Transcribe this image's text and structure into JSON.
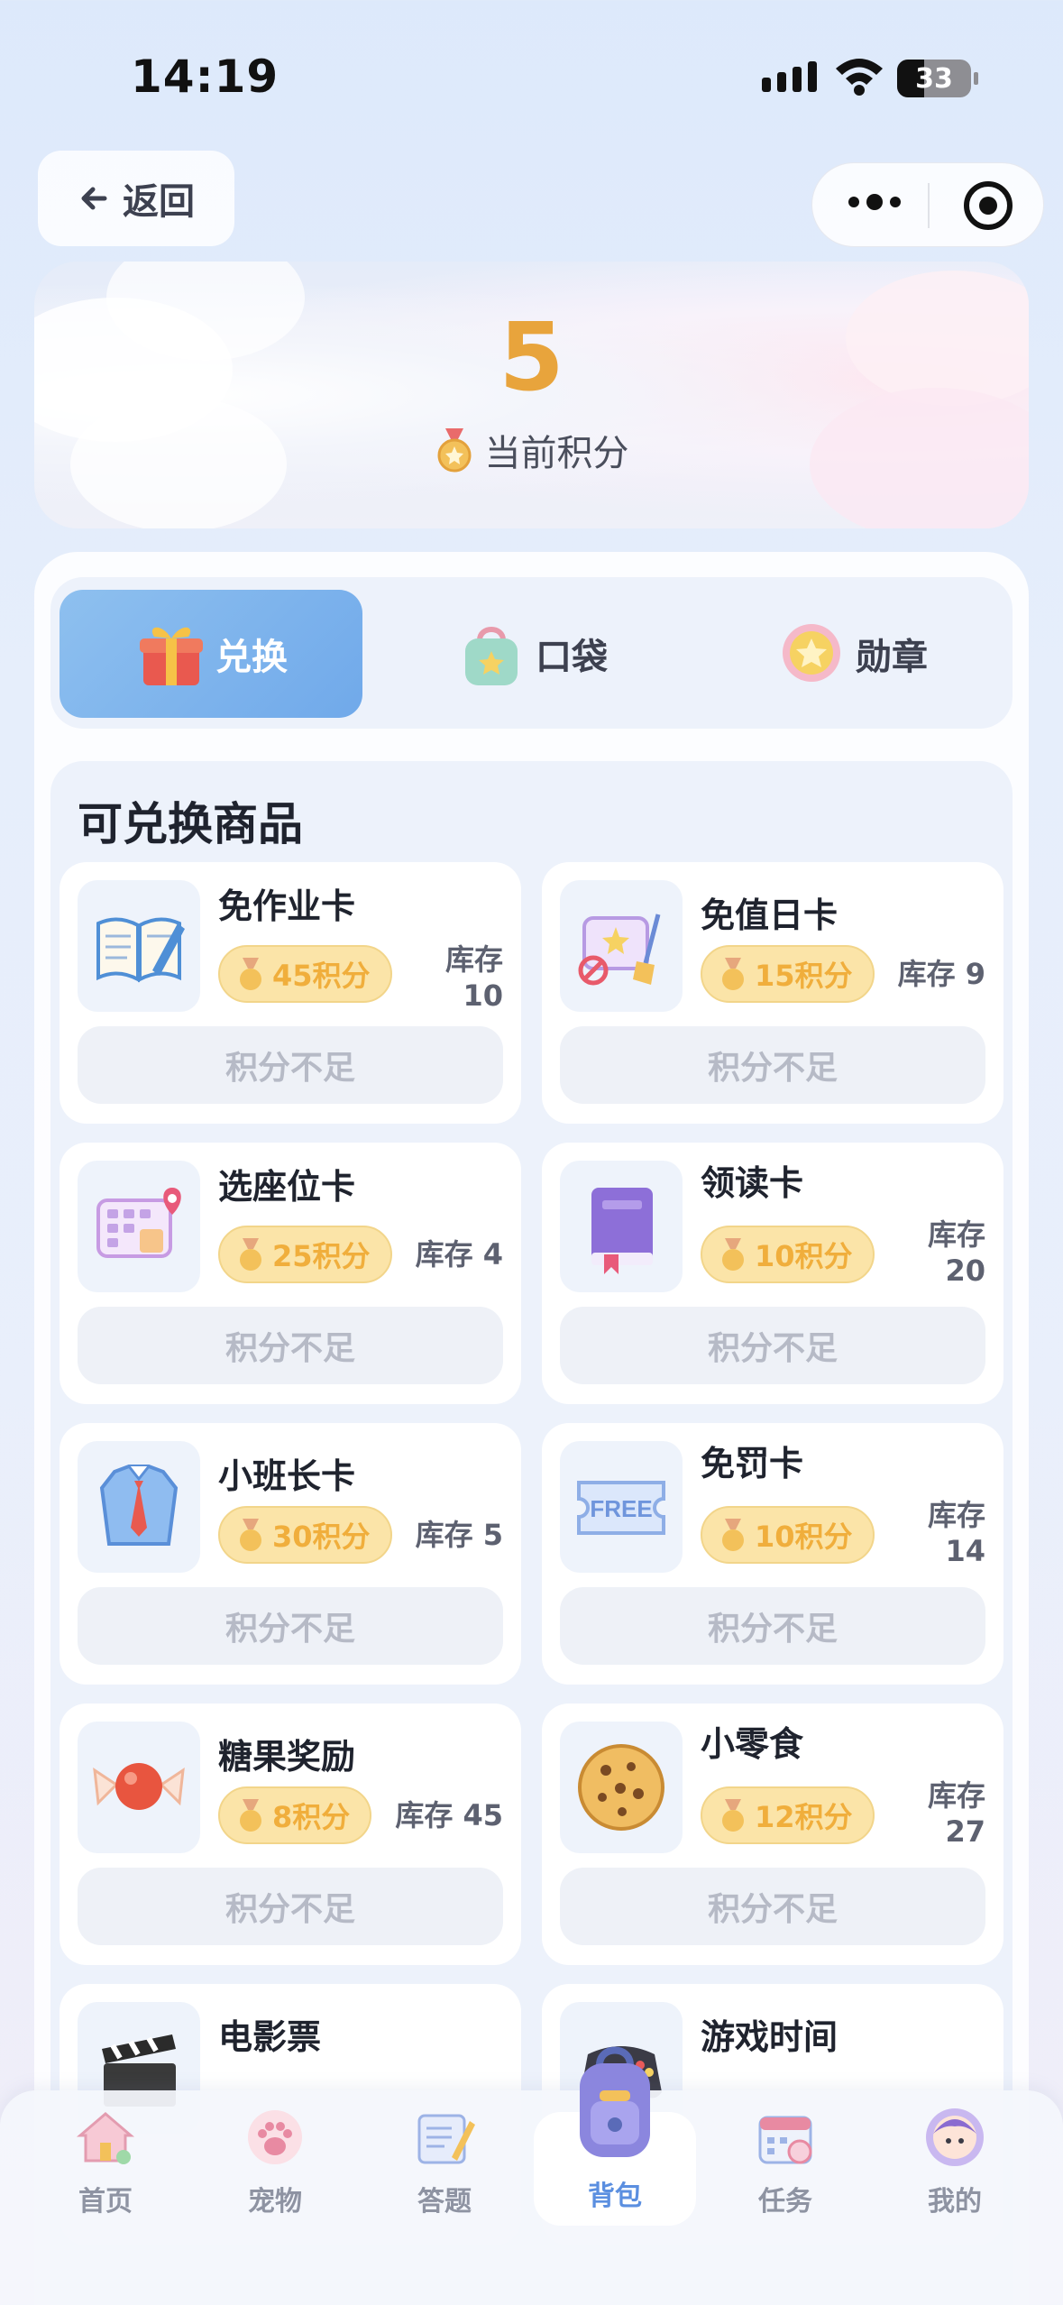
{
  "status_bar": {
    "time": "14:19",
    "battery": "33"
  },
  "top_bar": {
    "back_label": "返回"
  },
  "points": {
    "value": "5",
    "label": "当前积分"
  },
  "tabs": [
    {
      "label": "兑换",
      "icon": "gift-icon",
      "active": true
    },
    {
      "label": "口袋",
      "icon": "bag-icon",
      "active": false
    },
    {
      "label": "勋章",
      "icon": "medal-icon",
      "active": false
    }
  ],
  "goods": {
    "title": "可兑换商品",
    "items": [
      {
        "name": "免作业卡",
        "price": "45积分",
        "stock_label": "库存",
        "stock": "10",
        "button": "积分不足",
        "icon": "book-icon"
      },
      {
        "name": "免值日卡",
        "price": "15积分",
        "stock_label": "库存",
        "stock": "9",
        "button": "积分不足",
        "icon": "broom-ticket-icon"
      },
      {
        "name": "选座位卡",
        "price": "25积分",
        "stock_label": "库存",
        "stock": "4",
        "button": "积分不足",
        "icon": "seat-map-icon"
      },
      {
        "name": "领读卡",
        "price": "10积分",
        "stock_label": "库存",
        "stock": "20",
        "button": "积分不足",
        "icon": "purple-book-icon"
      },
      {
        "name": "小班长卡",
        "price": "30积分",
        "stock_label": "库存",
        "stock": "5",
        "button": "积分不足",
        "icon": "shirt-tie-icon"
      },
      {
        "name": "免罚卡",
        "price": "10积分",
        "stock_label": "库存",
        "stock": "14",
        "button": "积分不足",
        "icon": "free-ticket-icon"
      },
      {
        "name": "糖果奖励",
        "price": "8积分",
        "stock_label": "库存",
        "stock": "45",
        "button": "积分不足",
        "icon": "candy-icon"
      },
      {
        "name": "小零食",
        "price": "12积分",
        "stock_label": "库存",
        "stock": "27",
        "button": "积分不足",
        "icon": "cookie-icon"
      },
      {
        "name": "电影票",
        "icon": "clapperboard-icon"
      },
      {
        "name": "游戏时间",
        "icon": "gamepad-icon"
      }
    ]
  },
  "bottom_nav": [
    {
      "label": "首页",
      "icon": "home-icon"
    },
    {
      "label": "宠物",
      "icon": "paw-icon"
    },
    {
      "label": "答题",
      "icon": "quiz-icon"
    },
    {
      "label": "背包",
      "icon": "backpack-icon",
      "active": true
    },
    {
      "label": "任务",
      "icon": "calendar-icon"
    },
    {
      "label": "我的",
      "icon": "profile-icon"
    }
  ],
  "colors": {
    "accent": "#70a9ea",
    "points": "#e8a43c",
    "price_bg": "#fbe4a8",
    "nav_active": "#5b8fe0"
  }
}
